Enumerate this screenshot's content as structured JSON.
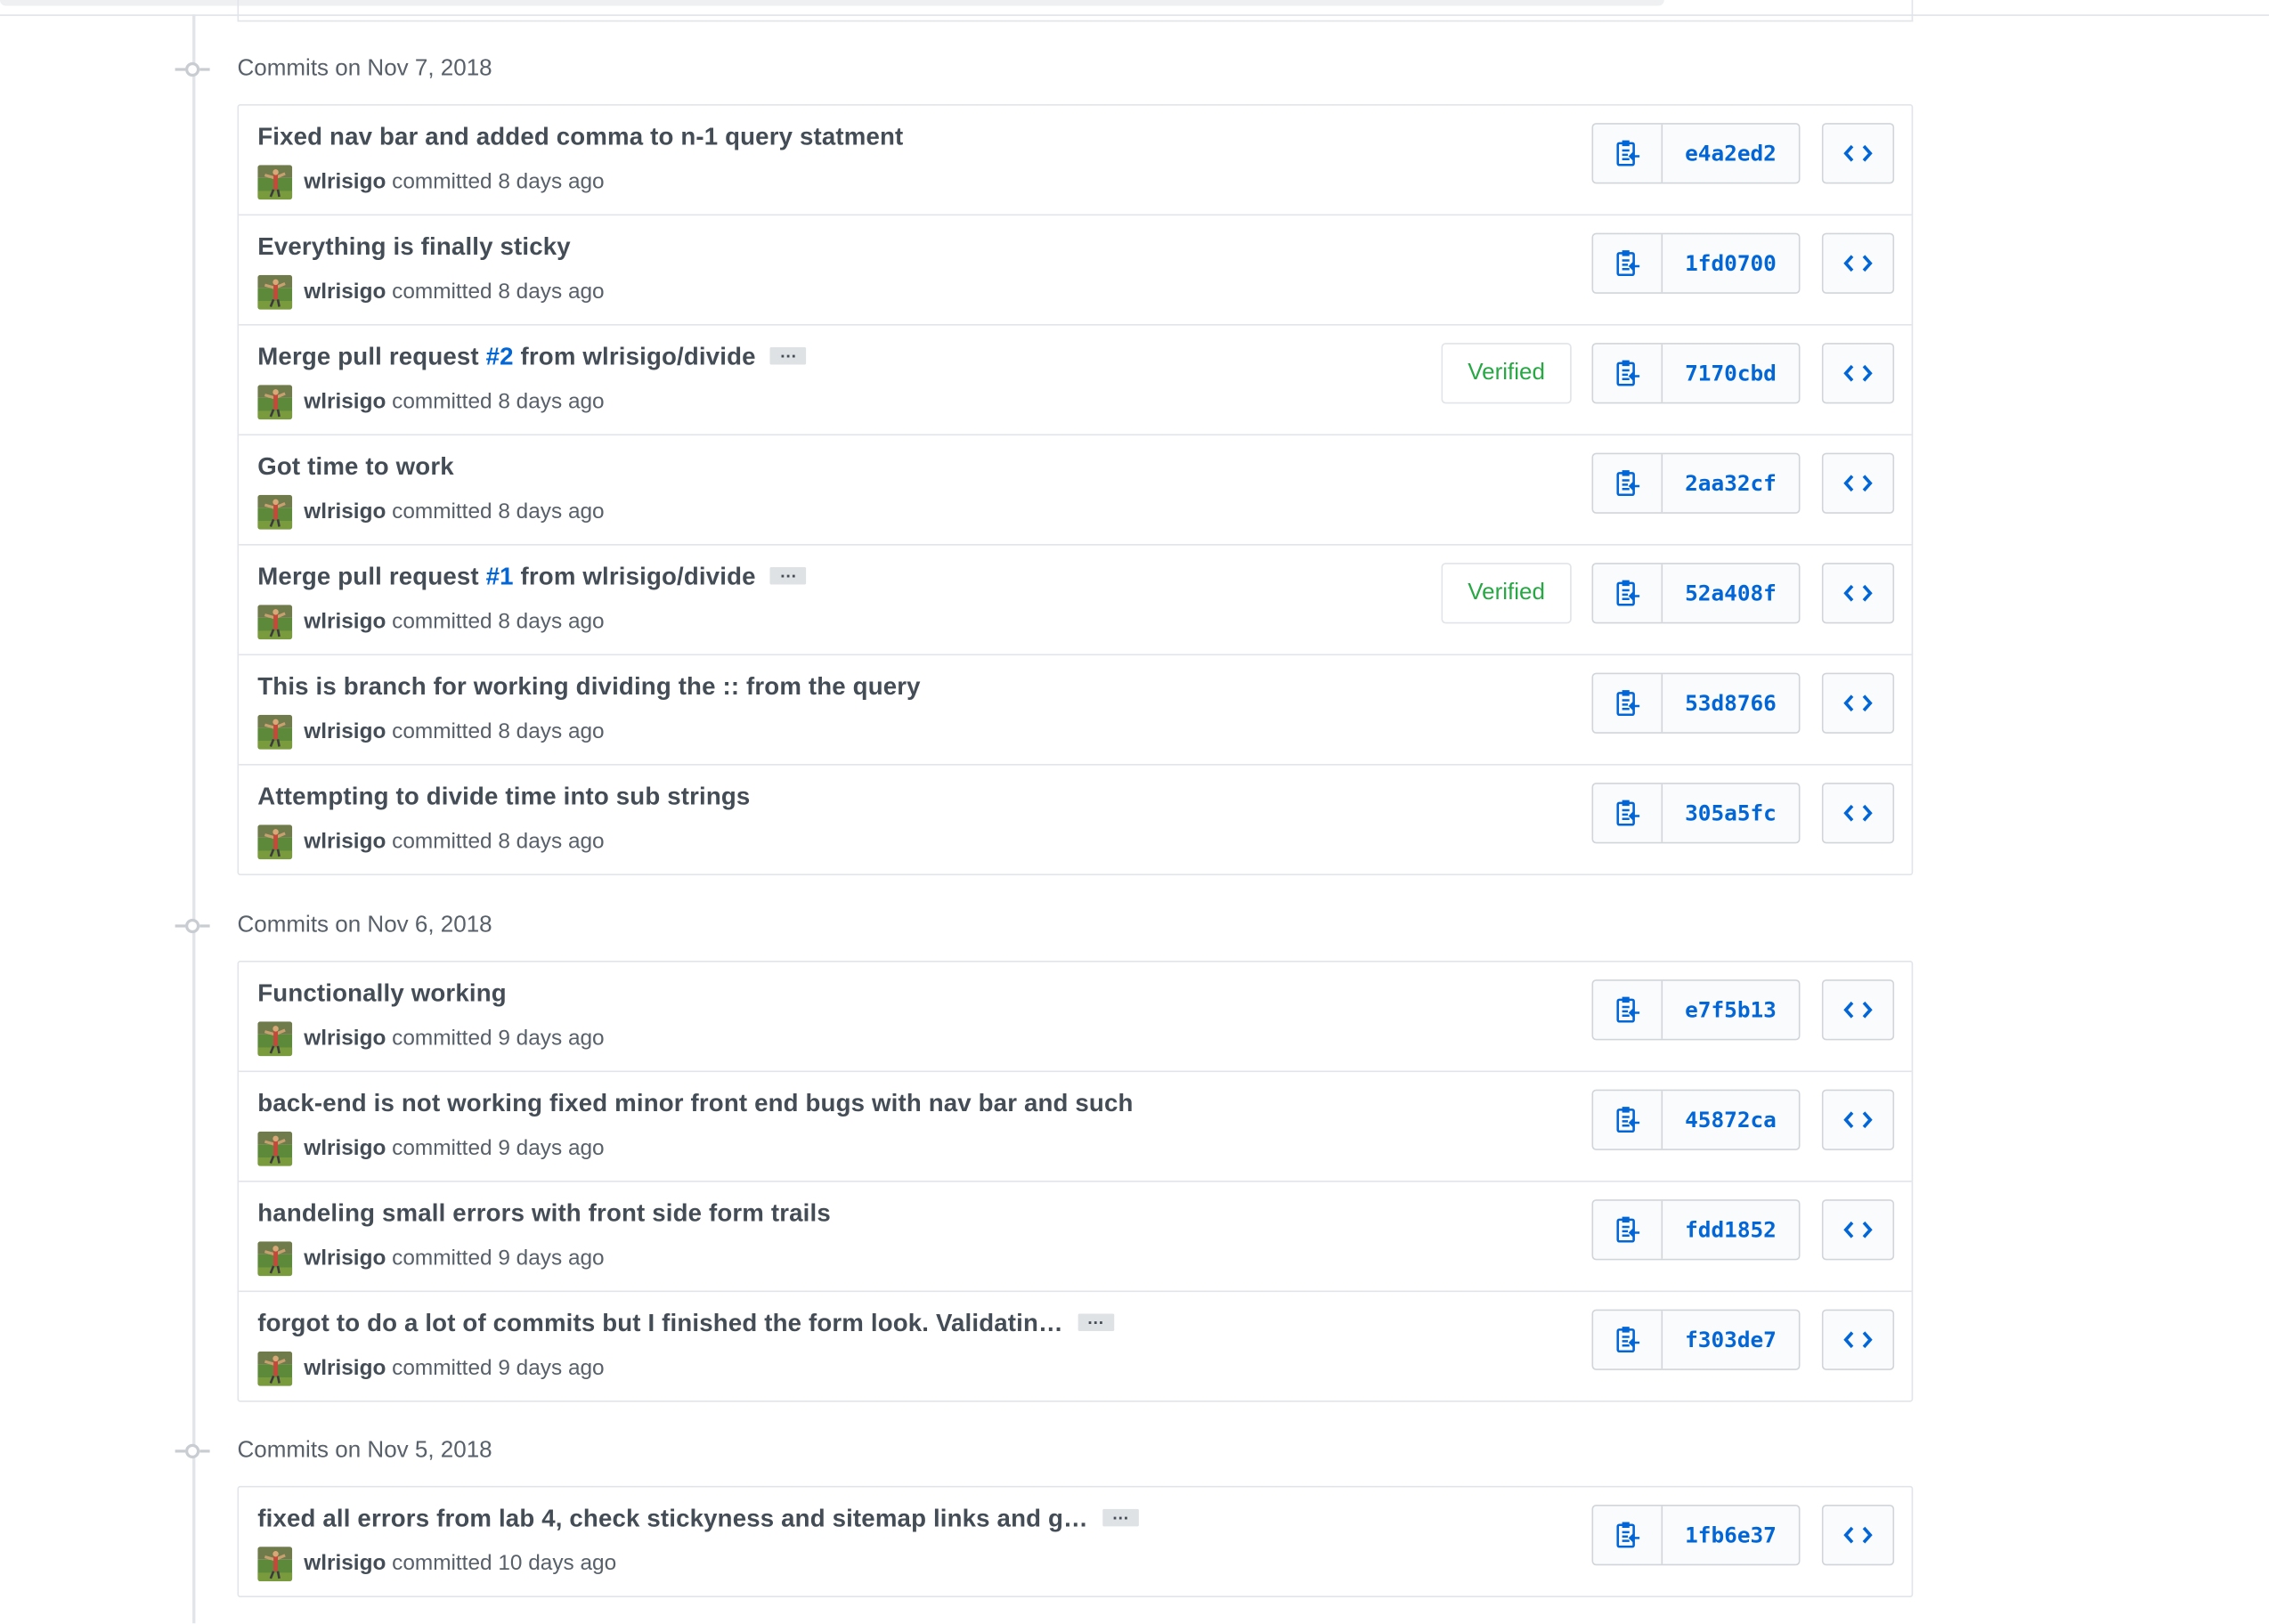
{
  "colors": {
    "link": "#0366d6",
    "verified": "#28a745",
    "text_muted": "#586069",
    "border": "#e1e4e8"
  },
  "icons": {
    "copy": "clippy-icon",
    "browse": "code-brackets-icon",
    "timeline_node": "git-commit-icon"
  },
  "groups": [
    {
      "header": "Commits on Nov 7, 2018",
      "commits": [
        {
          "title": "Fixed nav bar and added comma to n-1 query statment",
          "author": "wlrisigo",
          "action": "committed",
          "time": "8 days ago",
          "sha": "e4a2ed2",
          "verified": "",
          "pr_prefix": "",
          "pr_number": "",
          "pr_suffix": "",
          "truncated": false
        },
        {
          "title": "Everything is finally sticky",
          "author": "wlrisigo",
          "action": "committed",
          "time": "8 days ago",
          "sha": "1fd0700",
          "verified": "",
          "pr_prefix": "",
          "pr_number": "",
          "pr_suffix": "",
          "truncated": false
        },
        {
          "title": "",
          "author": "wlrisigo",
          "action": "committed",
          "time": "8 days ago",
          "sha": "7170cbd",
          "verified": "Verified",
          "pr_prefix": "Merge pull request ",
          "pr_number": "#2",
          "pr_suffix": " from wlrisigo/divide",
          "truncated": true
        },
        {
          "title": "Got time to work",
          "author": "wlrisigo",
          "action": "committed",
          "time": "8 days ago",
          "sha": "2aa32cf",
          "verified": "",
          "pr_prefix": "",
          "pr_number": "",
          "pr_suffix": "",
          "truncated": false
        },
        {
          "title": "",
          "author": "wlrisigo",
          "action": "committed",
          "time": "8 days ago",
          "sha": "52a408f",
          "verified": "Verified",
          "pr_prefix": "Merge pull request ",
          "pr_number": "#1",
          "pr_suffix": " from wlrisigo/divide",
          "truncated": true
        },
        {
          "title": "This is branch for working dividing the :: from the query",
          "author": "wlrisigo",
          "action": "committed",
          "time": "8 days ago",
          "sha": "53d8766",
          "verified": "",
          "pr_prefix": "",
          "pr_number": "",
          "pr_suffix": "",
          "truncated": false
        },
        {
          "title": "Attempting to divide time into sub strings",
          "author": "wlrisigo",
          "action": "committed",
          "time": "8 days ago",
          "sha": "305a5fc",
          "verified": "",
          "pr_prefix": "",
          "pr_number": "",
          "pr_suffix": "",
          "truncated": false
        }
      ]
    },
    {
      "header": "Commits on Nov 6, 2018",
      "commits": [
        {
          "title": "Functionally working",
          "author": "wlrisigo",
          "action": "committed",
          "time": "9 days ago",
          "sha": "e7f5b13",
          "verified": "",
          "pr_prefix": "",
          "pr_number": "",
          "pr_suffix": "",
          "truncated": false
        },
        {
          "title": "back-end is not working fixed minor front end bugs with nav bar and such",
          "author": "wlrisigo",
          "action": "committed",
          "time": "9 days ago",
          "sha": "45872ca",
          "verified": "",
          "pr_prefix": "",
          "pr_number": "",
          "pr_suffix": "",
          "truncated": false
        },
        {
          "title": "handeling small errors with front side form trails",
          "author": "wlrisigo",
          "action": "committed",
          "time": "9 days ago",
          "sha": "fdd1852",
          "verified": "",
          "pr_prefix": "",
          "pr_number": "",
          "pr_suffix": "",
          "truncated": false
        },
        {
          "title": "forgot to do a lot of commits but I finished the form look. Validatin…",
          "author": "wlrisigo",
          "action": "committed",
          "time": "9 days ago",
          "sha": "f303de7",
          "verified": "",
          "pr_prefix": "",
          "pr_number": "",
          "pr_suffix": "",
          "truncated": true
        }
      ]
    },
    {
      "header": "Commits on Nov 5, 2018",
      "commits": [
        {
          "title": "fixed all errors from lab 4, check stickyness and sitemap links and g…",
          "author": "wlrisigo",
          "action": "committed",
          "time": "10 days ago",
          "sha": "1fb6e37",
          "verified": "",
          "pr_prefix": "",
          "pr_number": "",
          "pr_suffix": "",
          "truncated": true
        }
      ]
    }
  ],
  "ellipsis_label": "…"
}
